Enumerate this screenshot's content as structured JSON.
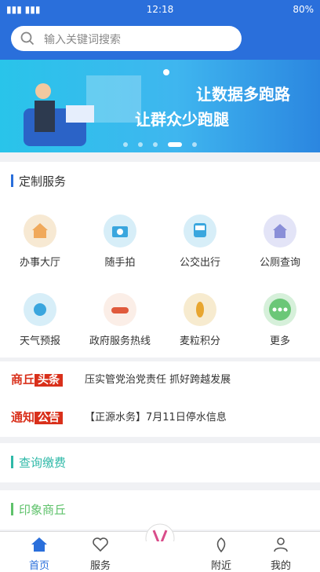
{
  "status": {
    "left": "▮▮▮ ▮▮▮",
    "time": "12:18",
    "right": "80%"
  },
  "search": {
    "placeholder": "输入关键词搜索"
  },
  "banner": {
    "line1": "让数据多跑路",
    "line2": "让群众少跑腿"
  },
  "sections": {
    "custom": "定制服务",
    "query": "查询缴费",
    "impression": "印象商丘"
  },
  "services": [
    {
      "label": "办事大厅",
      "icon": "hall-icon",
      "color": "#f7e9d3"
    },
    {
      "label": "随手拍",
      "icon": "camera-icon",
      "color": "#d7eef8"
    },
    {
      "label": "公交出行",
      "icon": "bus-icon",
      "color": "#d7eef8"
    },
    {
      "label": "公厕查询",
      "icon": "toilet-icon",
      "color": "#e3e4f7"
    },
    {
      "label": "天气预报",
      "icon": "weather-icon",
      "color": "#d7eef8"
    },
    {
      "label": "政府服务热线",
      "icon": "hotline-icon",
      "color": "#fbeee7"
    },
    {
      "label": "麦粒积分",
      "icon": "wheat-icon",
      "color": "#f7ebcf"
    },
    {
      "label": "更多",
      "icon": "more-icon",
      "color": "#d6f0da"
    }
  ],
  "news": {
    "headline_tag": "商丘",
    "headline_box": "头条",
    "headline_text": "压实管党治党责任 抓好跨越发展",
    "notice_tag": "通知",
    "notice_box": "公告",
    "notice_text": "【正源水务】7月11日停水信息"
  },
  "nav": {
    "home": "首页",
    "service": "服务",
    "nearby": "附近",
    "mine": "我的"
  }
}
